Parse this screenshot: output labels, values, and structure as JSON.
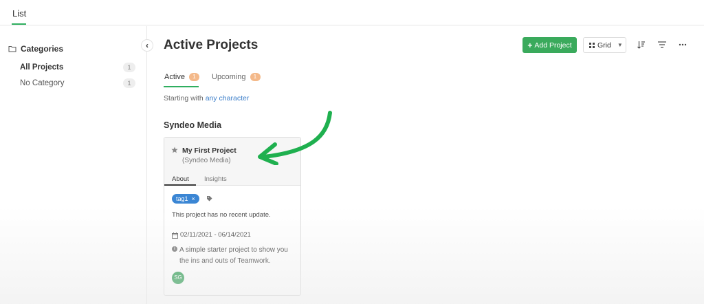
{
  "top": {
    "tab_label": "List"
  },
  "sidebar": {
    "heading": "Categories",
    "items": [
      {
        "label": "All Projects",
        "count": "1"
      },
      {
        "label": "No Category",
        "count": "1"
      }
    ]
  },
  "main": {
    "title": "Active Projects",
    "toolbar": {
      "add_label": "Add Project",
      "view_label": "Grid"
    },
    "tabs": [
      {
        "label": "Active",
        "count": "1"
      },
      {
        "label": "Upcoming",
        "count": "1"
      }
    ],
    "filter": {
      "prefix": "Starting with",
      "link": "any character"
    },
    "group_title": "Syndeo Media",
    "card": {
      "title": "My First Project",
      "subtitle": "(Syndeo Media)",
      "tabs": [
        "About",
        "Insights"
      ],
      "tag": "tag1",
      "update_text": "This project has no recent update.",
      "dates": "02/11/2021 - 06/14/2021",
      "description": "A simple starter project to show you the ins and outs of Teamwork.",
      "avatar_initials": "SG"
    }
  },
  "colors": {
    "accent": "#3aaa5c",
    "tag": "#3b86d4",
    "badge": "#f4b98a",
    "arrow": "#1fb04f"
  }
}
